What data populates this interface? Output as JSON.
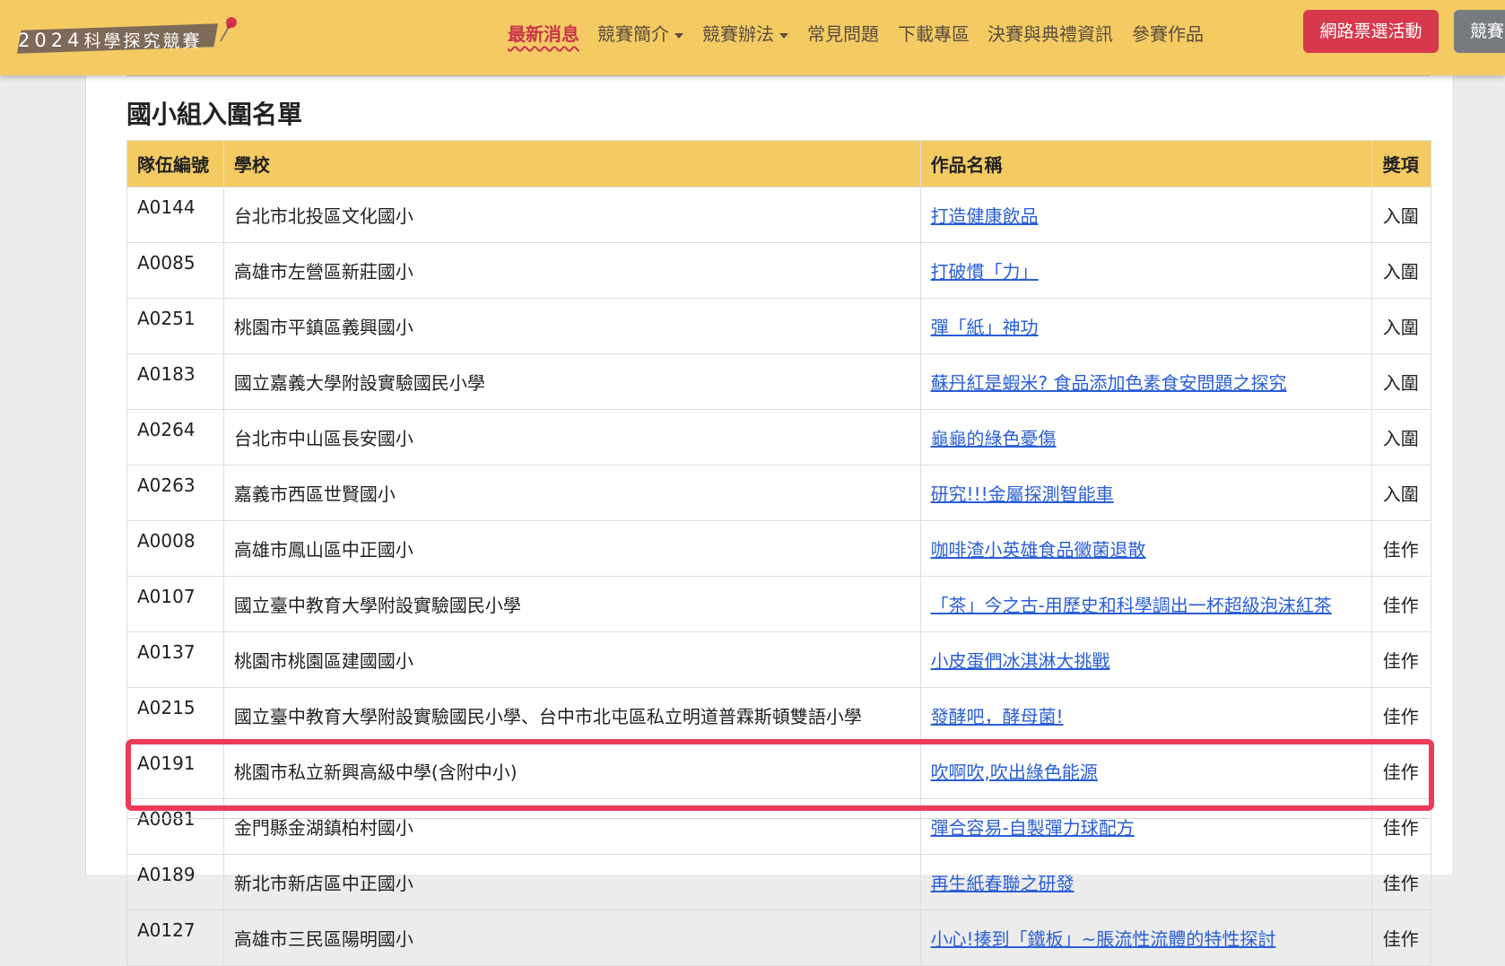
{
  "brand": {
    "year": "2024",
    "name": "科學探究競賽"
  },
  "nav": {
    "items": [
      {
        "label": "最新消息",
        "active": true
      },
      {
        "label": "競賽簡介",
        "dropdown": true
      },
      {
        "label": "競賽辦法",
        "dropdown": true
      },
      {
        "label": "常見問題"
      },
      {
        "label": "下載專區"
      },
      {
        "label": "決賽與典禮資訊"
      },
      {
        "label": "參賽作品"
      }
    ],
    "vote_button": "網路票選活動",
    "more_button": "競賽"
  },
  "section": {
    "title": "國小組入圍名單"
  },
  "table": {
    "headers": [
      "隊伍編號",
      "學校",
      "作品名稱",
      "獎項"
    ],
    "rows": [
      {
        "id": "A0144",
        "school": "台北市北投區文化國小",
        "title": "打造健康飲品",
        "award": "入圍"
      },
      {
        "id": "A0085",
        "school": "高雄市左營區新莊國小",
        "title": "打破慣「力」",
        "award": "入圍"
      },
      {
        "id": "A0251",
        "school": "桃園市平鎮區義興國小",
        "title": "彈「紙」神功",
        "award": "入圍"
      },
      {
        "id": "A0183",
        "school": "國立嘉義大學附設實驗國民小學",
        "title": "蘇丹紅是蝦米? 食品添加色素食安問題之探究",
        "award": "入圍"
      },
      {
        "id": "A0264",
        "school": "台北市中山區長安國小",
        "title": "龜龜的綠色憂傷",
        "award": "入圍"
      },
      {
        "id": "A0263",
        "school": "嘉義市西區世賢國小",
        "title": "研究!!!金屬探測智能車",
        "award": "入圍"
      },
      {
        "id": "A0008",
        "school": "高雄市鳳山區中正國小",
        "title": "咖啡渣小英雄食品黴菌退散",
        "award": "佳作"
      },
      {
        "id": "A0107",
        "school": "國立臺中教育大學附設實驗國民小學",
        "title": "「茶」今之古-用歷史和科學調出一杯超級泡沫紅茶",
        "award": "佳作"
      },
      {
        "id": "A0137",
        "school": "桃園市桃園區建國國小",
        "title": "小皮蛋們冰淇淋大挑戰",
        "award": "佳作"
      },
      {
        "id": "A0215",
        "school": "國立臺中教育大學附設實驗國民小學、台中市北屯區私立明道普霖斯頓雙語小學",
        "title": "發酵吧，酵母菌!",
        "award": "佳作"
      },
      {
        "id": "A0191",
        "school": "桃園市私立新興高級中學(含附中小)",
        "title": "吹啊吹,吹出綠色能源",
        "award": "佳作"
      },
      {
        "id": "A0081",
        "school": "金門縣金湖鎮柏村國小",
        "title": "彈合容易-自製彈力球配方",
        "award": "佳作"
      },
      {
        "id": "A0189",
        "school": "新北市新店區中正國小",
        "title": "再生紙春聯之研發",
        "award": "佳作"
      },
      {
        "id": "A0127",
        "school": "高雄市三民區陽明國小",
        "title": "小心!揍到「鐵板」~脹流性流體的特性探討",
        "award": "佳作"
      }
    ]
  },
  "colors": {
    "navbar": "#f4cb63",
    "accent": "#d7384b",
    "link": "#2a5fd6",
    "highlight": "#ed3a58"
  }
}
